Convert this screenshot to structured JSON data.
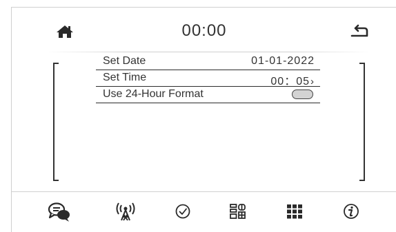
{
  "header": {
    "time": "00:00",
    "home_icon": "home-icon",
    "back_icon": "back-arrow-icon"
  },
  "settings": {
    "rows": [
      {
        "label": "Set Date",
        "value": "01-01-2022"
      },
      {
        "label": "Set Time",
        "value": "00：05",
        "chevron": "›"
      },
      {
        "label": "Use 24-Hour Format",
        "toggle_on": false
      }
    ]
  },
  "nav": {
    "icons": [
      "chat-bubbles-icon",
      "antenna-broadcast-icon",
      "check-circle-icon",
      "app-grid-icon",
      "keypad-grid-icon",
      "info-icon"
    ]
  },
  "colors": {
    "foreground": "#2a2a2a",
    "toggle_off": "#d3d3d3",
    "divider": "#d0d0d0"
  }
}
